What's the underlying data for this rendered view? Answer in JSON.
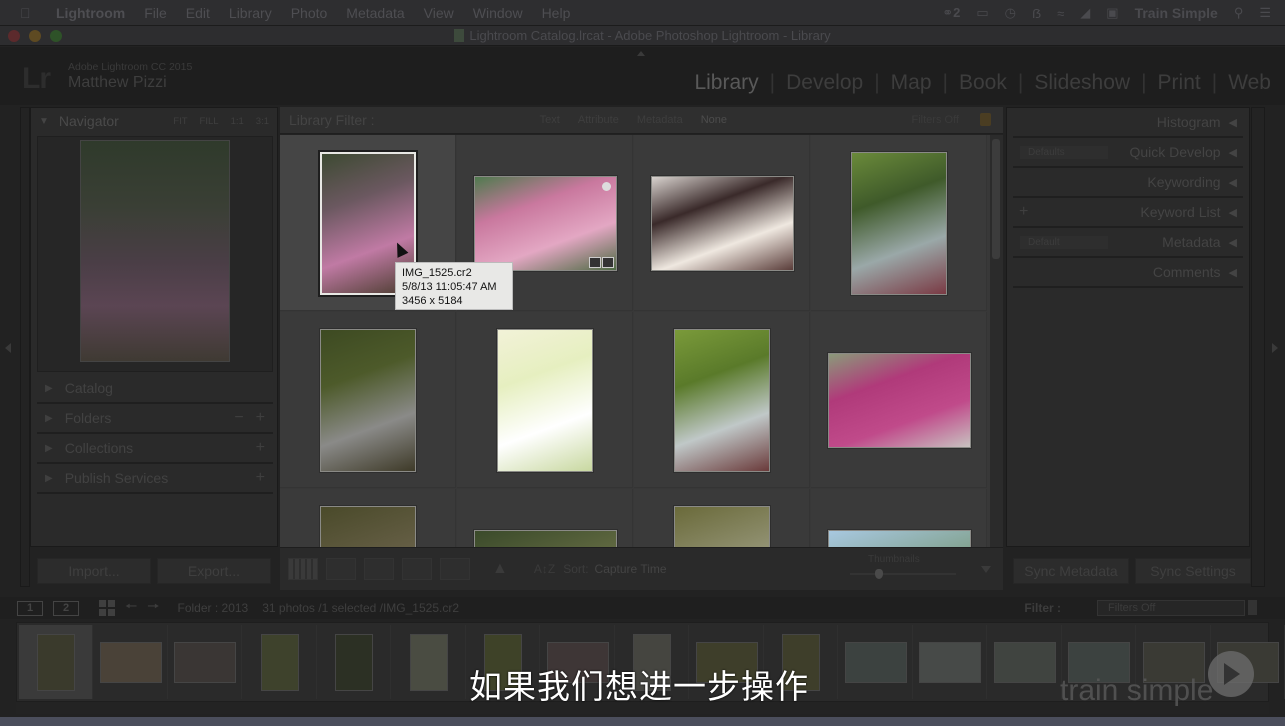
{
  "menubar": {
    "apple_icon": "apple-icon",
    "app_name": "Lightroom",
    "items": [
      "File",
      "Edit",
      "Library",
      "Photo",
      "Metadata",
      "View",
      "Window",
      "Help"
    ],
    "status": {
      "cc_count": "2",
      "user": "Train Simple"
    }
  },
  "window": {
    "title": "Lightroom Catalog.lrcat - Adobe Photoshop Lightroom - Library"
  },
  "identity": {
    "logo": "Lr",
    "product": "Adobe Lightroom CC 2015",
    "user_name": "Matthew Pizzi"
  },
  "modules": [
    {
      "label": "Library",
      "active": true
    },
    {
      "label": "Develop",
      "active": false
    },
    {
      "label": "Map",
      "active": false
    },
    {
      "label": "Book",
      "active": false
    },
    {
      "label": "Slideshow",
      "active": false
    },
    {
      "label": "Print",
      "active": false
    },
    {
      "label": "Web",
      "active": false
    }
  ],
  "left_panel": {
    "navigator": {
      "title": "Navigator",
      "zoom_options": [
        "FIT",
        "FILL",
        "1:1",
        "3:1"
      ]
    },
    "sections": [
      {
        "label": "Catalog",
        "controls": []
      },
      {
        "label": "Folders",
        "controls": [
          "−",
          "+"
        ]
      },
      {
        "label": "Collections",
        "controls": [
          "+"
        ]
      },
      {
        "label": "Publish Services",
        "controls": [
          "+"
        ]
      }
    ],
    "import_label": "Import...",
    "export_label": "Export..."
  },
  "library_filter": {
    "title": "Library Filter :",
    "options": [
      "Text",
      "Attribute",
      "Metadata",
      "None"
    ],
    "selected": "None",
    "status": "Filters Off"
  },
  "grid": {
    "selected_index": 1,
    "cells": [
      {
        "index": 1,
        "orientation": "portrait",
        "colors": [
          "#3d4a32",
          "#6b5860",
          "#c07aa4",
          "#4a3c2e"
        ],
        "selected": true
      },
      {
        "index": 2,
        "orientation": "landscape",
        "colors": [
          "#4f7a4e",
          "#c9789e",
          "#e3a7c3",
          "#4e6b44"
        ],
        "badges": true
      },
      {
        "index": 3,
        "orientation": "landscape",
        "colors": [
          "#d8d2ce",
          "#3a2a2a",
          "#efe8e0",
          "#5a3d3a"
        ]
      },
      {
        "index": 4,
        "orientation": "portrait",
        "colors": [
          "#6a8a3a",
          "#3f5a2a",
          "#9aa8a8",
          "#7a3a44"
        ]
      },
      {
        "index": 5,
        "orientation": "portrait",
        "colors": [
          "#3d4a22",
          "#4d5a2a",
          "#8a8a88",
          "#3e3a28"
        ]
      },
      {
        "index": 6,
        "orientation": "portrait",
        "colors": [
          "#f2f2d8",
          "#e6efc0",
          "#ffffff",
          "#c8d8a0"
        ]
      },
      {
        "index": 7,
        "orientation": "portrait",
        "colors": [
          "#7a9a3a",
          "#5a7a2a",
          "#c0c8c8",
          "#6a3a3a"
        ]
      },
      {
        "index": 8,
        "orientation": "landscape",
        "colors": [
          "#8a9a7a",
          "#b03a7a",
          "#c04a8a",
          "#c8c2c0"
        ]
      },
      {
        "index": 9,
        "orientation": "portrait",
        "colors": [
          "#4a4a2a",
          "#8a7a6a"
        ]
      },
      {
        "index": 10,
        "orientation": "landscape",
        "colors": [
          "#3a4a2a",
          "#8a8a5a"
        ]
      },
      {
        "index": 11,
        "orientation": "portrait",
        "colors": [
          "#6a6a3a",
          "#c8c8c0"
        ]
      },
      {
        "index": 12,
        "orientation": "landscape",
        "colors": [
          "#a8c8e0",
          "#5a7a3a"
        ]
      }
    ],
    "tooltip": {
      "filename": "IMG_1525.cr2",
      "datetime": "5/8/13 11:05:47 AM",
      "dimensions": "3456 x 5184"
    }
  },
  "toolbar": {
    "sort_label": "Sort:",
    "sort_value": "Capture Time",
    "thumbnails_label": "Thumbnails",
    "thumbnail_size": 0.25
  },
  "right_panel": {
    "sections": [
      {
        "label": "Histogram"
      },
      {
        "label": "Quick Develop",
        "preset": "Defaults"
      },
      {
        "label": "Keywording"
      },
      {
        "label": "Keyword List",
        "plus": true
      },
      {
        "label": "Metadata",
        "preset": "Default"
      },
      {
        "label": "Comments"
      }
    ],
    "sync_metadata_label": "Sync Metadata",
    "sync_settings_label": "Sync Settings"
  },
  "filmstrip_bar": {
    "screen1": "1",
    "screen2": "2",
    "folder": "Folder : 2013",
    "count": "31 photos /1 selected /IMG_1525.cr2",
    "filter_label": "Filter :",
    "filter_value": "Filters Off"
  },
  "filmstrip": {
    "thumbs": [
      {
        "o": "portrait",
        "c": "#3a3a2c"
      },
      {
        "o": "landscape",
        "c": "#4a4238"
      },
      {
        "o": "landscape",
        "c": "#3a3634"
      },
      {
        "o": "portrait",
        "c": "#3e422c"
      },
      {
        "o": "portrait",
        "c": "#2c3024"
      },
      {
        "o": "portrait",
        "c": "#4a4c42"
      },
      {
        "o": "portrait",
        "c": "#3e4228"
      },
      {
        "o": "landscape",
        "c": "#3e3636"
      },
      {
        "o": "portrait",
        "c": "#454540"
      },
      {
        "o": "landscape",
        "c": "#3e3e2a"
      },
      {
        "o": "portrait",
        "c": "#3e3e2a"
      },
      {
        "o": "landscape",
        "c": "#3c4240"
      },
      {
        "o": "landscape",
        "c": "#474a48"
      },
      {
        "o": "landscape",
        "c": "#404440"
      },
      {
        "o": "landscape",
        "c": "#3c4240"
      },
      {
        "o": "landscape",
        "c": "#3a3a34"
      },
      {
        "o": "landscape",
        "c": "#3a3a34"
      }
    ]
  },
  "overlay": {
    "subtitle": "如果我们想进一步操作",
    "watermark": "train simple"
  }
}
